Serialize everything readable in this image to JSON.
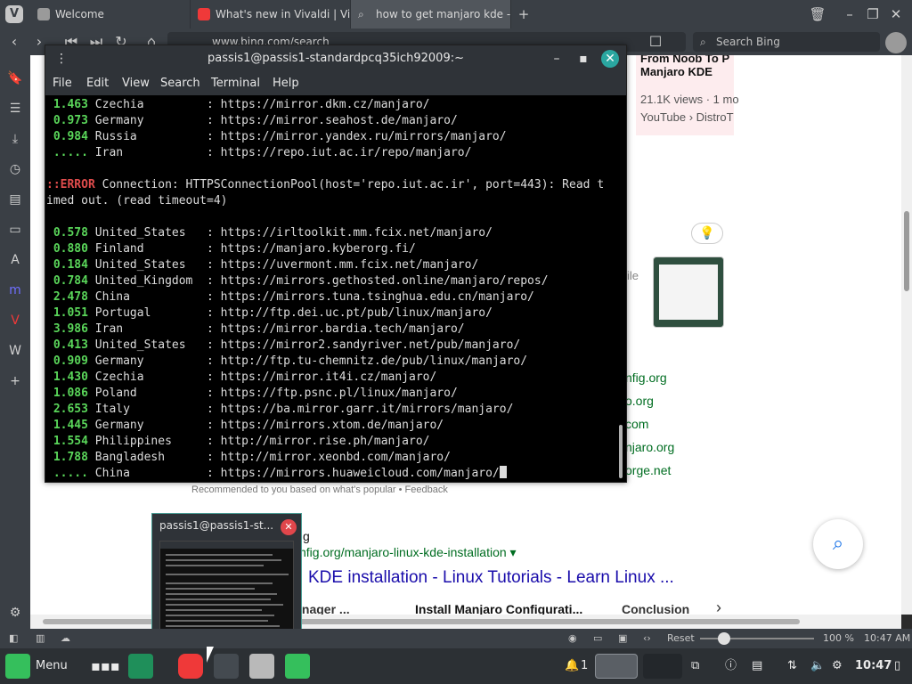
{
  "tabs": [
    {
      "title": "Welcome",
      "icon": "vivaldi-icon",
      "active": false
    },
    {
      "title": "What's new in Vivaldi | Viva",
      "icon": "vivaldi-icon",
      "active": false
    },
    {
      "title": "how to get manjaro kde - S",
      "icon": "search-icon",
      "active": true
    }
  ],
  "address_bar": {
    "url": "www.bing.com/search",
    "search_placeholder": "Search Bing"
  },
  "webpage": {
    "video_title": "From Noob To P",
    "video_title2": "Manjaro KDE",
    "video_views": "21.1K views · 1 mo",
    "video_source": "YouTube › DistroT",
    "file_fragment": "ile",
    "domain_fragments": [
      "nfig.org",
      "o.org",
      "com",
      "njaro.org",
      "orge.net"
    ],
    "recommended_note": "Recommended to you based on what's popular • Feedback",
    "result_site_fragment": "g",
    "result_url": "nfig.org/manjaro-linux-kde-installation ▾",
    "result_title": "KDE installation - Linux Tutorials - Learn Linux ...",
    "section_tabs": [
      "av Manager ...",
      "Install Manjaro Configurati...",
      "Conclusion"
    ]
  },
  "terminal": {
    "title": "passis1@passis1-standardpcq35ich92009:~",
    "menu": [
      "File",
      "Edit",
      "View",
      "Search",
      "Terminal",
      "Help"
    ],
    "lines": [
      {
        "num": "1.463",
        "country": "Czechia       ",
        "url": ": https://mirror.dkm.cz/manjaro/"
      },
      {
        "num": "0.973",
        "country": "Germany       ",
        "url": ": https://mirror.seahost.de/manjaro/"
      },
      {
        "num": "0.984",
        "country": "Russia        ",
        "url": ": https://mirror.yandex.ru/mirrors/manjaro/"
      },
      {
        "num": ".....",
        "country": "Iran          ",
        "url": ": https://repo.iut.ac.ir/repo/manjaro/"
      }
    ],
    "error_prefix": "::",
    "error_label": "ERROR",
    "error_text": " Connection: HTTPSConnectionPool(host='repo.iut.ac.ir', port=443): Read t",
    "error_text2": "imed out. (read timeout=4)",
    "lines2": [
      {
        "num": "0.578",
        "country": "United_States ",
        "url": ": https://irltoolkit.mm.fcix.net/manjaro/"
      },
      {
        "num": "0.880",
        "country": "Finland       ",
        "url": ": https://manjaro.kyberorg.fi/"
      },
      {
        "num": "0.184",
        "country": "United_States ",
        "url": ": https://uvermont.mm.fcix.net/manjaro/"
      },
      {
        "num": "0.784",
        "country": "United_Kingdom",
        "url": ": https://mirrors.gethosted.online/manjaro/repos/"
      },
      {
        "num": "2.478",
        "country": "China         ",
        "url": ": https://mirrors.tuna.tsinghua.edu.cn/manjaro/"
      },
      {
        "num": "1.051",
        "country": "Portugal      ",
        "url": ": http://ftp.dei.uc.pt/pub/linux/manjaro/"
      },
      {
        "num": "3.986",
        "country": "Iran          ",
        "url": ": https://mirror.bardia.tech/manjaro/"
      },
      {
        "num": "0.413",
        "country": "United_States ",
        "url": ": https://mirror2.sandyriver.net/pub/manjaro/"
      },
      {
        "num": "0.909",
        "country": "Germany       ",
        "url": ": http://ftp.tu-chemnitz.de/pub/linux/manjaro/"
      },
      {
        "num": "1.430",
        "country": "Czechia       ",
        "url": ": https://mirror.it4i.cz/manjaro/"
      },
      {
        "num": "1.086",
        "country": "Poland        ",
        "url": ": https://ftp.psnc.pl/linux/manjaro/"
      },
      {
        "num": "2.653",
        "country": "Italy         ",
        "url": ": https://ba.mirror.garr.it/mirrors/manjaro/"
      },
      {
        "num": "1.445",
        "country": "Germany       ",
        "url": ": https://mirrors.xtom.de/manjaro/"
      },
      {
        "num": "1.554",
        "country": "Philippines   ",
        "url": ": http://mirror.rise.ph/manjaro/"
      },
      {
        "num": "1.788",
        "country": "Bangladesh    ",
        "url": ": http://mirror.xeonbd.com/manjaro/"
      },
      {
        "num": ".....",
        "country": "China         ",
        "url": ": https://mirrors.huaweicloud.com/manjaro/"
      }
    ]
  },
  "preview": {
    "title": "passis1@passis1-st..."
  },
  "statusbar": {
    "reset": "Reset",
    "zoom": "100 %",
    "time": "10:47 AM"
  },
  "taskbar": {
    "menu": "Menu",
    "notifications": "1",
    "clock": "10:47"
  },
  "colors": {
    "accent": "#35bf5c",
    "terminal_number": "#5ad65a",
    "error": "#e04c4c",
    "vivaldi": "#ef3939"
  }
}
